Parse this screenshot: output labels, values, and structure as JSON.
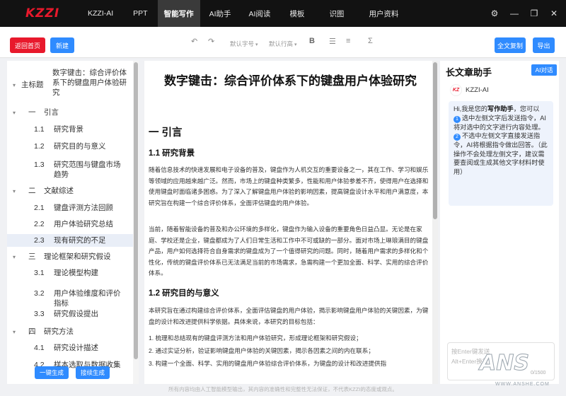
{
  "app": {
    "logo_text": "KZZI"
  },
  "nav": {
    "items": [
      "KZZI-AI",
      "PPT",
      "智能写作",
      "AI助手",
      "AI阅读",
      "模板",
      "识图",
      "用户资料"
    ],
    "active_index": 2
  },
  "window_controls": [
    "gear-icon",
    "minimize-icon",
    "restore-icon",
    "close-icon"
  ],
  "toolbar": {
    "back_home": "返回首页",
    "new": "新建",
    "font_size": "默认字号",
    "line_height": "默认行高",
    "bold": "B",
    "sigma": "Σ",
    "copy_all": "全文复制",
    "export": "导出"
  },
  "outline": {
    "root_label": "主标题",
    "root_title": "数字键击：综合评价体系下的键盘用户体验研究",
    "items": [
      {
        "num": "一",
        "text": "引言",
        "level": 1
      },
      {
        "num": "1.1",
        "text": "研究背景",
        "level": 2
      },
      {
        "num": "1.2",
        "text": "研究目的与意义",
        "level": 2
      },
      {
        "num": "1.3",
        "text": "研究范围与键盘市场趋势",
        "level": 2
      },
      {
        "num": "二",
        "text": "文献综述",
        "level": 1
      },
      {
        "num": "2.1",
        "text": "键盘评测方法回顾",
        "level": 2
      },
      {
        "num": "2.2",
        "text": "用户体验研究总结",
        "level": 2
      },
      {
        "num": "2.3",
        "text": "现有研究的不足",
        "level": 2
      },
      {
        "num": "三",
        "text": "理论框架和研究假设",
        "level": 1
      },
      {
        "num": "3.1",
        "text": "理论模型构建",
        "level": 2
      },
      {
        "num": "3.2",
        "text": "用户体验维度和评价指标",
        "level": 2
      },
      {
        "num": "3.3",
        "text": "研究假设提出",
        "level": 2
      },
      {
        "num": "四",
        "text": "研究方法",
        "level": 1
      },
      {
        "num": "4.1",
        "text": "研究设计描述",
        "level": 2
      },
      {
        "num": "4.2",
        "text": "样本选取与数据收集",
        "level": 2
      }
    ],
    "selected_index": 7,
    "generate_all": "一键生成",
    "continue_generate": "接续生成"
  },
  "document": {
    "title": "数字键击：综合评价体系下的键盘用户体验研究",
    "h_intro": "一 引言",
    "h_background": "1.1 研究背景",
    "p1": "随着信息技术的快速发展和电子设备的普及，键盘作为人机交互的重要设备之一，其在工作、学习和娱乐等领域的应用越来越广泛。然而，市场上的键盘种类繁多，性能和用户体验参差不齐，使得用户在选择和使用键盘时面临诸多困惑。为了深入了解键盘用户体验的影响因素，提高键盘设计水平和用户满意度，本研究旨在构建一个综合评价体系，全面评估键盘的用户体验。",
    "p2": "当前，随着智能设备的普及和办公环境的多样化，键盘作为输入设备的重要角色日益凸显。无论是在家庭、学校还是企业，键盘都成为了人们日常生活和工作中不可或缺的一部分。面对市场上琳琅满目的键盘产品，用户如何选择符合自身需求的键盘成为了一个值得研究的问题。同时，随着用户需求的多样化和个性化，传统的键盘评价体系已无法满足当前的市场需求，急需构建一个更加全面、科学、实用的综合评价体系。",
    "h_purpose": "1.2 研究目的与意义",
    "p3": "本研究旨在通过构建综合评价体系，全面评估键盘的用户体验，揭示影响键盘用户体验的关键因素，为键盘的设计和改进提供科学依据。具体来说，本研究的目标包括：",
    "list": [
      "1. 梳理和总结现有的键盘评测方法和用户体验研究，形成理论框架和研究假设；",
      "2. 通过实证分析，验证影响键盘用户体验的关键因素，揭示各因素之间的内在联系；",
      "3. 构建一个全面、科学、实用的键盘用户体验综合评价体系，为键盘的设计和改进提供指"
    ]
  },
  "assistant": {
    "title": "长文章助手",
    "chat_tag": "AI对话",
    "bot_name": "KZZI-AI",
    "greeting_pre": "Hi,我是您的",
    "greeting_bold": "写作助手",
    "greeting_post": "，您可以",
    "tip1": "选中左侧文字后发送指令，AI将对选中的文字进行内容处理。",
    "tip2": "不选中左侧文字直接发送指令，AI将根据指令做出回答。（此操作不会处理左侧文字，建议需要查阅或生成其他文字材料时使用）",
    "input_placeholder_1": "按Enter键发送",
    "input_placeholder_2": "Alt+Enter换行",
    "counter": "0/1500"
  },
  "footer": "所有内容均由人工智能模型输出，其内容的准确性和完整性无法保证，不代表KZZI的态度或观点。",
  "watermark": {
    "big": "ANS",
    "small": "WWW.ANSHE.COM"
  }
}
